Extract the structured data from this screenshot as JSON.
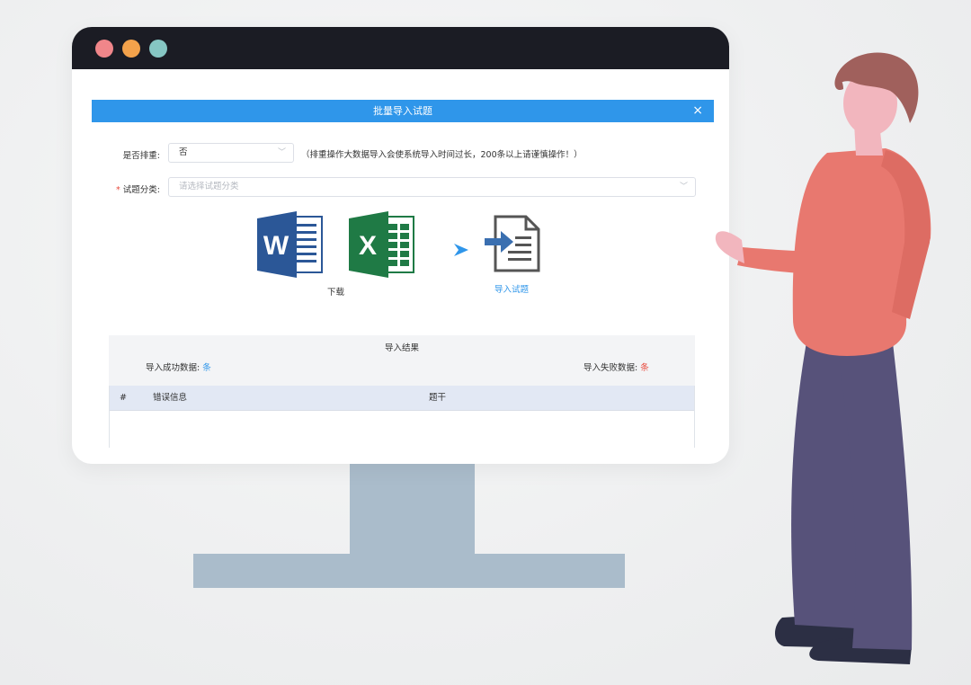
{
  "dialog": {
    "title": "批量导入试题",
    "close_glyph": "×",
    "dedupe": {
      "label": "是否排重:",
      "value": "否",
      "hint": "（排重操作大数据导入会使系统导入时间过长，200条以上请谨慎操作！）"
    },
    "category": {
      "required_mark": "*",
      "label": "试题分类:",
      "placeholder": "请选择试题分类"
    },
    "download_label": "下载",
    "import_label": "导入试题",
    "icons": {
      "word": "word-document-icon",
      "excel": "excel-spreadsheet-icon",
      "arrow": "arrow-right-icon",
      "import": "import-document-icon"
    },
    "result": {
      "title": "导入结果",
      "success_label": "导入成功数据:",
      "success_unit": "条",
      "fail_label": "导入失败数据:",
      "fail_unit": "条"
    },
    "table": {
      "columns": [
        "#",
        "错误信息",
        "题干"
      ]
    }
  },
  "colors": {
    "primary": "#2f96ea",
    "danger": "#e84a3d",
    "titlebar": "#1b1c24",
    "stand": "#aabccb",
    "traffic_red": "#f0868a",
    "traffic_orange": "#f3a24b",
    "traffic_teal": "#86c6c3",
    "word_blue": "#2b5797",
    "excel_green": "#1f7a45"
  }
}
